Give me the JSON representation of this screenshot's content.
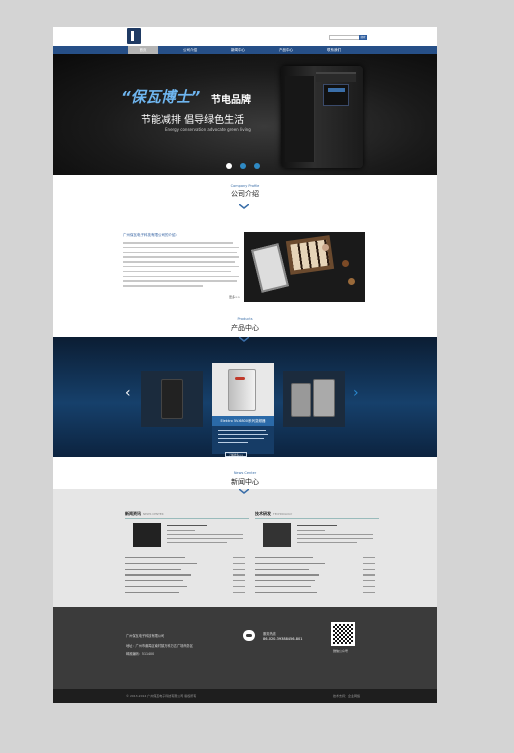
{
  "header": {
    "search_placeholder": "",
    "search_button": "搜索"
  },
  "nav": {
    "items": [
      "首页",
      "公司介绍",
      "新闻中心",
      "产品中心",
      "联系我们"
    ]
  },
  "banner": {
    "title_brand": "“保瓦博士”",
    "title_suffix": "节电品牌",
    "slogan": "节能减排 倡导绿色生活",
    "slogan_en": "Energy conservation advocate green living"
  },
  "about": {
    "heading_en": "Company Profile",
    "heading_zh": "公司介绍",
    "company_name": "广州保瓦电子科技有限公司的介绍：",
    "more": "更多>>"
  },
  "products": {
    "heading_en": "Products",
    "heading_zh": "产品中心",
    "featured_caption": "Elektro 5V.6800系列变频器",
    "more": "了解更多>>"
  },
  "news": {
    "heading_en": "News Center",
    "heading_zh": "新闻中心",
    "col1_title": "新闻资讯",
    "col1_title_en": "NEWS CENTER",
    "col2_title": "技术研发",
    "col2_title_en": "TECHNOLOGY"
  },
  "footer": {
    "company": "广州保瓦电子科技有限公司",
    "address": "地址：广州市番禺区南村镇万科万达广场商务区",
    "postcode": "邮政编码：511400",
    "hotline_label": "服务热线",
    "hotline": "86-020-39388456-801",
    "qr_label": "微信公众号",
    "copyright": "© 2013-2014 广州保瓦电子科技有限公司 版权所有",
    "support": "技术支持：企业网络"
  },
  "colors": {
    "nav": "#264f87",
    "accent": "#3a6ea8",
    "footer": "#3b3b3b"
  }
}
